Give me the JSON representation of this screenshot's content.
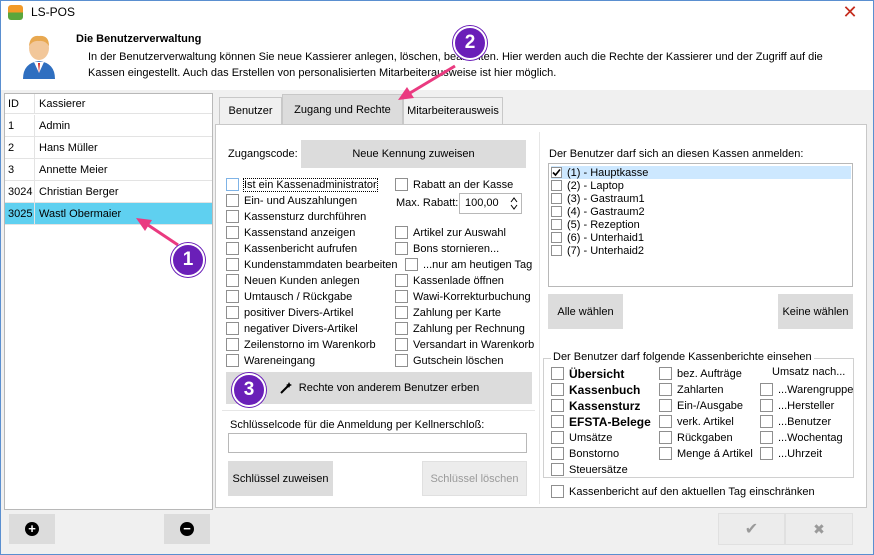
{
  "window": {
    "title": "LS-POS",
    "close_symbol": "✕"
  },
  "header": {
    "title": "Die Benutzerverwaltung",
    "description": "In der Benutzerverwaltung können Sie neue Kassierer anlegen, löschen, bearbeiten. Hier werden auch die Rechte der Kassierer und der Zugriff auf die Kassen eingestellt. Auch das Erstellen von personalisierten Mitarbeiterausweise ist hier möglich."
  },
  "user_list": {
    "columns": [
      "ID",
      "Kassierer"
    ],
    "rows": [
      {
        "id": "1",
        "name": "Admin"
      },
      {
        "id": "2",
        "name": "Hans Müller"
      },
      {
        "id": "3",
        "name": "Annette Meier"
      },
      {
        "id": "3024",
        "name": "Christian Berger"
      },
      {
        "id": "3025",
        "name": "Wastl Obermaier"
      }
    ]
  },
  "tabs": [
    "Benutzer",
    "Zugang und Rechte",
    "Mitarbeiterausweis"
  ],
  "access": {
    "code_label": "Zugangscode:",
    "new_code_button": "Neue Kennung zuweisen",
    "left_rights": [
      "Ist ein Kassenadministrator",
      "Ein- und Auszahlungen",
      "Kassensturz durchführen",
      "Kassenstand anzeigen",
      "Kassenbericht aufrufen",
      "Kundenstammdaten bearbeiten",
      "Neuen Kunden anlegen",
      "Umtausch / Rückgabe",
      "positiver Divers-Artikel",
      "negativer Divers-Artikel",
      "Zeilenstorno im Warenkorb",
      "Wareneingang"
    ],
    "right_rights": [
      "Rabatt an der Kasse",
      "Artikel zur Auswahl",
      "Bons stornieren...",
      "...nur am heutigen Tag",
      "Kassenlade öffnen",
      "Wawi-Korrekturbuchung",
      "Zahlung per Karte",
      "Zahlung per Rechnung",
      "Versandart in Warenkorb",
      "Gutschein löschen"
    ],
    "max_rabatt_label": "Max. Rabatt:",
    "max_rabatt_value": "100,00",
    "inherit_button": "Rechte von anderem Benutzer erben",
    "key_label": "Schlüsselcode für die Anmeldung per Kellnerschloß:",
    "key_value": "",
    "assign_key_button": "Schlüssel zuweisen",
    "delete_key_button": "Schlüssel löschen"
  },
  "registers": {
    "label": "Der Benutzer darf sich an diesen Kassen anmelden:",
    "items": [
      {
        "name": "(1) - Hauptkasse",
        "checked": true
      },
      {
        "name": "(2) - Laptop",
        "checked": false
      },
      {
        "name": "(3) - Gastraum1",
        "checked": false
      },
      {
        "name": "(4) - Gastraum2",
        "checked": false
      },
      {
        "name": "(5) - Rezeption",
        "checked": false
      },
      {
        "name": "(6) - Unterhaid1",
        "checked": false
      },
      {
        "name": "(7) - Unterhaid2",
        "checked": false
      }
    ],
    "select_all": "Alle wählen",
    "select_none": "Keine wählen"
  },
  "reports": {
    "legend": "Der Benutzer darf folgende Kassenberichte einsehen",
    "col1": [
      "Übersicht",
      "Kassenbuch",
      "Kassensturz",
      "EFSTA-Belege",
      "Umsätze",
      "Bonstorno",
      "Steuersätze"
    ],
    "col2": [
      "bez. Aufträge",
      "Zahlarten",
      "Ein-/Ausgabe",
      "verk. Artikel",
      "Rückgaben",
      "Menge á Artikel"
    ],
    "col3_header": "Umsatz nach...",
    "col3": [
      "...Warengruppe",
      "...Hersteller",
      "...Benutzer",
      "...Wochentag",
      "...Uhrzeit"
    ],
    "restrict_today": "Kassenbericht auf den aktuellen Tag einschränken"
  },
  "bottom": {
    "add_symbol": "+",
    "remove_symbol": "−",
    "ok_symbol": "✔",
    "cancel_symbol": "✖"
  },
  "annotations": [
    "1",
    "2",
    "3"
  ],
  "colors": {
    "selection": "#5fd0f0",
    "annotation": "#6a1fb8",
    "arrow": "#ea3a80"
  }
}
